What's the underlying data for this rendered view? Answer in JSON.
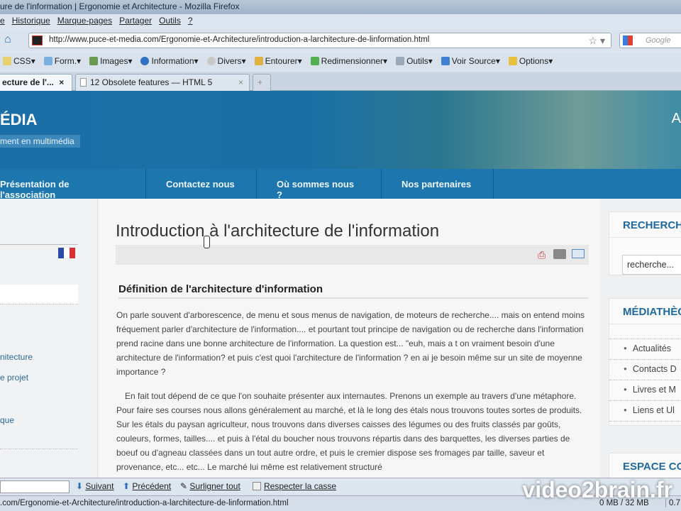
{
  "window": {
    "title": "ure de l'information | Ergonomie et Architecture - Mozilla Firefox"
  },
  "menu": [
    "e",
    "Historique",
    "Marque-pages",
    "Partager",
    "Outils",
    "?"
  ],
  "navbar": {
    "url": "http://www.puce-et-media.com/Ergonomie-et-Architecture/introduction-a-larchitecture-de-linformation.html",
    "search_placeholder": "Google"
  },
  "toolbar": [
    {
      "label": "CSS",
      "color": "#e8d070"
    },
    {
      "label": "Form.",
      "color": "#7ab0e0"
    },
    {
      "label": "Images",
      "color": "#6a9a50"
    },
    {
      "label": "Information",
      "color": "#3070c0"
    },
    {
      "label": "Divers",
      "color": "#c8c8c8"
    },
    {
      "label": "Entourer",
      "color": "#e0b040"
    },
    {
      "label": "Redimensionner",
      "color": "#50b050"
    },
    {
      "label": "Outils",
      "color": "#9aa8b8"
    },
    {
      "label": "Voir Source",
      "color": "#4080d0"
    },
    {
      "label": "Options",
      "color": "#e8c040"
    }
  ],
  "tabs": [
    {
      "label": "ecture de l'...",
      "close": "×"
    },
    {
      "label": "12 Obsolete features — HTML 5",
      "close": "×"
    },
    {
      "label": "+"
    }
  ],
  "header": {
    "logo": "ÉDIA",
    "tagline": "ment en multimédia",
    "right": "A"
  },
  "mainnav": [
    "Présentation de l'association",
    "Contactez nous",
    "Où sommes nous ?",
    "Nos partenaires"
  ],
  "leftcol": {
    "links": [
      "nitecture",
      "e projet",
      "que"
    ]
  },
  "article": {
    "title": "Introduction à l'architecture de l'information",
    "subtitle": "Définition de l'architecture d'information",
    "p1": "On parle souvent d'arborescence, de menu et sous menus de navigation, de moteurs de recherche.... mais on entend moins fréquement parler d'architecture de l'information.... et pourtant tout principe de navigation ou de recherche dans l'information prend racine dans une bonne architecture de l'information. La question est... \"euh, mais a t on vraiment besoin d'une architecture de l'information? et puis c'est quoi l'architecture de l'information ? en ai je besoin même sur un site de moyenne importance ?",
    "p2": "En fait tout dépend de ce que l'on souhaite présenter aux internautes. Prenons un exemple au travers d'une métaphore. Pour faire ses courses nous allons généralement au marché, et là le long des étals nous trouvons toutes sortes de produits. Sur les étals du paysan agriculteur, nous trouvons dans diverses caisses des légumes ou des fruits classés par goûts, couleurs, formes, tailles.... et puis à l'étal du boucher nous trouvons répartis dans des barquettes, les diverses parties de boeuf ou d'agneau classées dans un tout autre ordre, et puis le cremier dispose ses fromages par taille, saveur et provenance, etc... etc... Le marché lui même est relativement structuré"
  },
  "rightcol": {
    "search_title": "RECHERCHE",
    "search_placeholder": "recherche...",
    "media_title": "MÉDIATHÈQUE",
    "media_items": [
      "Actualités",
      "Contacts D",
      "Livres et M",
      "Liens et Ul"
    ],
    "espace_title": "ESPACE CO"
  },
  "findbar": {
    "next": "Suivant",
    "prev": "Précédent",
    "highlight": "Surligner tout",
    "match_case": "Respecter la casse"
  },
  "statusbar": {
    "url": ".com/Ergonomie-et-Architecture/introduction-a-larchitecture-de-linformation.html",
    "memory": "0 MB / 32 MB",
    "extra": "0.7"
  },
  "watermark": "video2brain.fr"
}
